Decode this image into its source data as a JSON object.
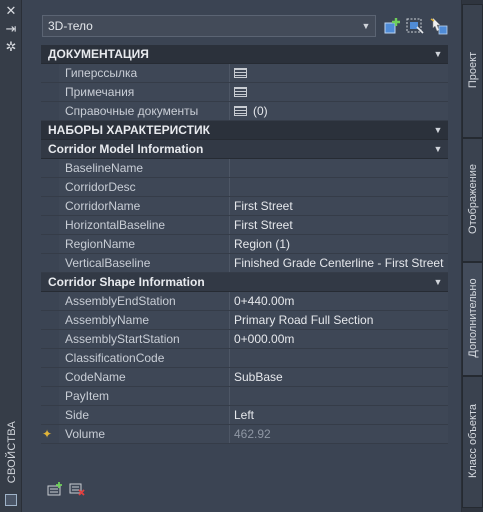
{
  "palette": {
    "title": "СВОЙСТВА"
  },
  "selector": {
    "value": "3D-тело"
  },
  "sections": {
    "documentation": {
      "label": "ДОКУМЕНТАЦИЯ",
      "rows": [
        {
          "name": "Гиперссылка",
          "value": ""
        },
        {
          "name": "Примечания",
          "value": ""
        },
        {
          "name": "Справочные документы",
          "value": "(0)"
        }
      ]
    },
    "property_sets": {
      "label": "НАБОРЫ ХАРАКТЕРИСТИК"
    },
    "corridor_model": {
      "label": "Corridor Model Information",
      "rows": [
        {
          "name": "BaselineName",
          "value": ""
        },
        {
          "name": "CorridorDesc",
          "value": ""
        },
        {
          "name": "CorridorName",
          "value": "First Street"
        },
        {
          "name": "HorizontalBaseline",
          "value": "First Street"
        },
        {
          "name": "RegionName",
          "value": "Region (1)"
        },
        {
          "name": "VerticalBaseline",
          "value": "Finished Grade Centerline - First Street"
        }
      ]
    },
    "corridor_shape": {
      "label": "Corridor Shape Information",
      "rows": [
        {
          "name": "AssemblyEndStation",
          "value": "0+440.00m"
        },
        {
          "name": "AssemblyName",
          "value": "Primary Road Full Section"
        },
        {
          "name": "AssemblyStartStation",
          "value": "0+000.00m"
        },
        {
          "name": "ClassificationCode",
          "value": ""
        },
        {
          "name": "CodeName",
          "value": "SubBase"
        },
        {
          "name": "PayItem",
          "value": ""
        },
        {
          "name": "Side",
          "value": "Left"
        },
        {
          "name": "Volume",
          "value": "462.92"
        }
      ]
    }
  },
  "tabs": [
    {
      "label": "Проект"
    },
    {
      "label": "Отображение"
    },
    {
      "label": "Дополнительно"
    },
    {
      "label": "Класс объекта"
    }
  ],
  "colors": {
    "accent_star": "#e0b43a",
    "background": "#3b4453"
  }
}
